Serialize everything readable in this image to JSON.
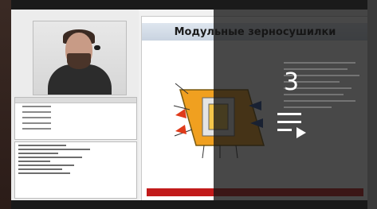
{
  "slide": {
    "title": "Модульные зерносушилки"
  },
  "overlay": {
    "playlist_count": "3",
    "icon": "playlist-play-icon"
  },
  "colors": {
    "accent_red": "#c21b1b",
    "overlay": "#141414"
  }
}
